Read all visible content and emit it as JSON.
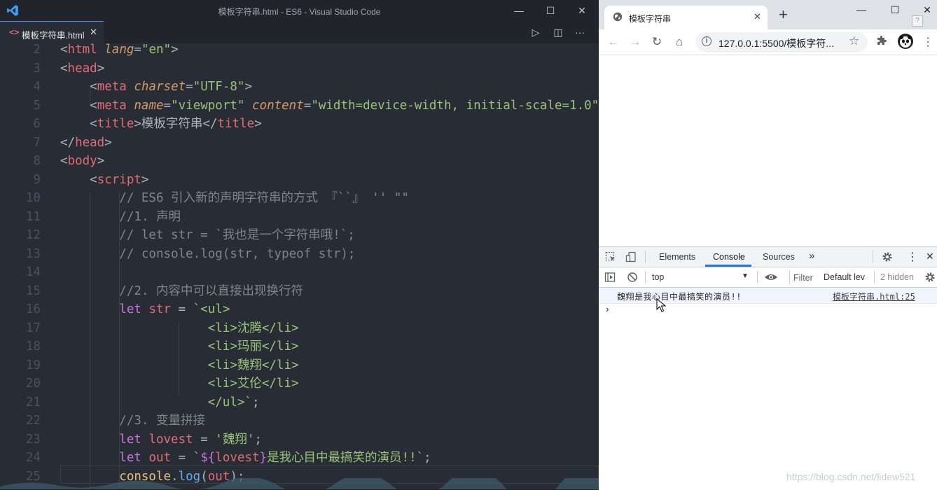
{
  "vscode": {
    "window_title": "模板字符串.html - ES6 - Visual Studio Code",
    "tab": {
      "icon": "<>",
      "label": "模板字符串.html",
      "close": "✕"
    },
    "window_controls": {
      "minimize": "—",
      "maximize": "☐",
      "close": "✕"
    },
    "editor_actions": {
      "run": "▷",
      "split": "◫",
      "more": "···"
    },
    "lines": [
      {
        "num": "2",
        "tokens": [
          [
            "t-pun",
            "<"
          ],
          [
            "t-tag",
            "html"
          ],
          [
            "t-pun",
            " "
          ],
          [
            "t-attr",
            "lang"
          ],
          [
            "t-pun",
            "="
          ],
          [
            "t-str",
            "\"en\""
          ],
          [
            "t-pun",
            ">"
          ]
        ]
      },
      {
        "num": "3",
        "tokens": [
          [
            "t-pun",
            "<"
          ],
          [
            "t-tag",
            "head"
          ],
          [
            "t-pun",
            ">"
          ]
        ]
      },
      {
        "num": "4",
        "tokens": [
          [
            "t-pun",
            "    <"
          ],
          [
            "t-tag",
            "meta"
          ],
          [
            "t-pun",
            " "
          ],
          [
            "t-attr",
            "charset"
          ],
          [
            "t-pun",
            "="
          ],
          [
            "t-str",
            "\"UTF-8\""
          ],
          [
            "t-pun",
            ">"
          ]
        ]
      },
      {
        "num": "5",
        "tokens": [
          [
            "t-pun",
            "    <"
          ],
          [
            "t-tag",
            "meta"
          ],
          [
            "t-pun",
            " "
          ],
          [
            "t-attr",
            "name"
          ],
          [
            "t-pun",
            "="
          ],
          [
            "t-str",
            "\"viewport\""
          ],
          [
            "t-pun",
            " "
          ],
          [
            "t-attr",
            "content"
          ],
          [
            "t-pun",
            "="
          ],
          [
            "t-str",
            "\"width=device-width, initial-scale=1.0\""
          ],
          [
            "t-pun",
            ">"
          ]
        ]
      },
      {
        "num": "6",
        "tokens": [
          [
            "t-pun",
            "    <"
          ],
          [
            "t-tag",
            "title"
          ],
          [
            "t-pun",
            ">"
          ],
          [
            "t-pun",
            "模板字符串"
          ],
          [
            "t-pun",
            "</"
          ],
          [
            "t-tag",
            "title"
          ],
          [
            "t-pun",
            ">"
          ]
        ]
      },
      {
        "num": "7",
        "tokens": [
          [
            "t-pun",
            "</"
          ],
          [
            "t-tag",
            "head"
          ],
          [
            "t-pun",
            ">"
          ]
        ]
      },
      {
        "num": "8",
        "tokens": [
          [
            "t-pun",
            "<"
          ],
          [
            "t-tag",
            "body"
          ],
          [
            "t-pun",
            ">"
          ]
        ]
      },
      {
        "num": "9",
        "tokens": [
          [
            "t-pun",
            "    <"
          ],
          [
            "t-tag",
            "script"
          ],
          [
            "t-pun",
            ">"
          ]
        ]
      },
      {
        "num": "10",
        "tokens": [
          [
            "t-com",
            "        // ES6 引入新的声明字符串的方式 『``』 '' \"\""
          ]
        ]
      },
      {
        "num": "11",
        "tokens": [
          [
            "t-com",
            "        //1. 声明"
          ]
        ]
      },
      {
        "num": "12",
        "tokens": [
          [
            "t-com",
            "        // let str = `我也是一个字符串哦!`;"
          ]
        ]
      },
      {
        "num": "13",
        "tokens": [
          [
            "t-com",
            "        // console.log(str, typeof str);"
          ]
        ]
      },
      {
        "num": "14",
        "tokens": []
      },
      {
        "num": "15",
        "tokens": [
          [
            "t-com",
            "        //2. 内容中可以直接出现换行符"
          ]
        ]
      },
      {
        "num": "16",
        "tokens": [
          [
            "t-kw",
            "        let"
          ],
          [
            "t-id",
            " str"
          ],
          [
            "t-pun",
            " = "
          ],
          [
            "t-str",
            "`<ul>"
          ]
        ]
      },
      {
        "num": "17",
        "tokens": [
          [
            "t-str",
            "                    <li>沈腾</li>"
          ]
        ]
      },
      {
        "num": "18",
        "tokens": [
          [
            "t-str",
            "                    <li>玛丽</li>"
          ]
        ]
      },
      {
        "num": "19",
        "tokens": [
          [
            "t-str",
            "                    <li>魏翔</li>"
          ]
        ]
      },
      {
        "num": "20",
        "tokens": [
          [
            "t-str",
            "                    <li>艾伦</li>"
          ]
        ]
      },
      {
        "num": "21",
        "tokens": [
          [
            "t-str",
            "                    </ul>`"
          ],
          [
            "t-pun",
            ";"
          ]
        ]
      },
      {
        "num": "22",
        "tokens": [
          [
            "t-com",
            "        //3. 变量拼接"
          ]
        ]
      },
      {
        "num": "23",
        "tokens": [
          [
            "t-kw",
            "        let"
          ],
          [
            "t-id",
            " lovest"
          ],
          [
            "t-pun",
            " = "
          ],
          [
            "t-str",
            "'魏翔'"
          ],
          [
            "t-pun",
            ";"
          ]
        ]
      },
      {
        "num": "24",
        "tokens": [
          [
            "t-kw",
            "        let"
          ],
          [
            "t-id",
            " out"
          ],
          [
            "t-pun",
            " = "
          ],
          [
            "t-str",
            "`"
          ],
          [
            "t-tpl",
            "${"
          ],
          [
            "t-id",
            "lovest"
          ],
          [
            "t-tpl",
            "}"
          ],
          [
            "t-str",
            "是我心目中最搞笑的演员!!`"
          ],
          [
            "t-pun",
            ";"
          ]
        ]
      },
      {
        "num": "25",
        "tokens": [
          [
            "t-var",
            "        console"
          ],
          [
            "t-pun",
            "."
          ],
          [
            "t-fn",
            "log"
          ],
          [
            "t-pun",
            "("
          ],
          [
            "t-id",
            "out"
          ],
          [
            "t-pun",
            ");"
          ]
        ]
      }
    ]
  },
  "browser": {
    "tab_title": "模板字符串",
    "tab_close": "✕",
    "new_tab": "+",
    "window_controls": {
      "minimize": "—",
      "maximize": "☐",
      "close": "✕"
    },
    "help": "?",
    "nav": {
      "back": "←",
      "forward": "→",
      "reload": "↻",
      "home": "⌂"
    },
    "url": "127.0.0.1:5500/模板字符...",
    "bookmark": "☆",
    "menu": "⋮",
    "devtools": {
      "tabs": [
        "Elements",
        "Console",
        "Sources"
      ],
      "more_tabs": "»",
      "close": "✕",
      "menu": "⋮",
      "context": "top",
      "filter_placeholder": "Filter",
      "levels": "Default lev",
      "hidden": "2 hidden",
      "message": "魏翔是我心目中最搞笑的演员!!",
      "message_source": "模板字符串.html:25",
      "prompt": "›"
    }
  },
  "watermark": "https://blog.csdn.net/lidew521",
  "colors": {
    "editor_bg": "#282c34",
    "titlebar_bg": "#21252b",
    "accent_blue": "#1a73e8",
    "tag_red": "#e06c75",
    "string_green": "#98c379",
    "keyword_purple": "#c678dd"
  }
}
